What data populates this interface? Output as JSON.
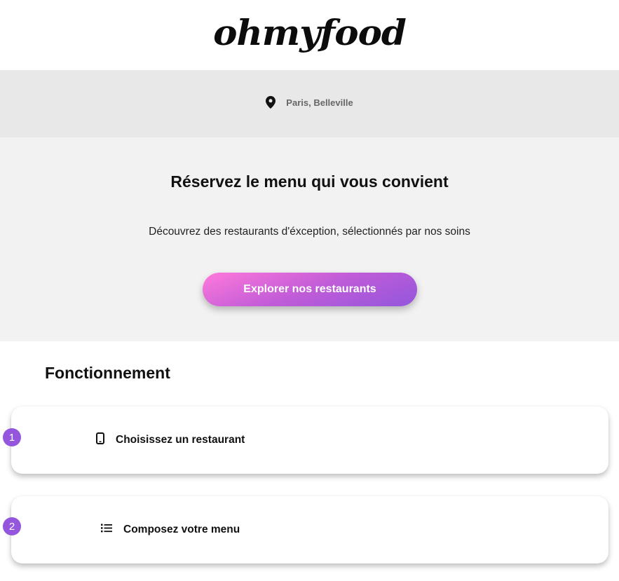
{
  "header": {
    "logo": "ohmyfood"
  },
  "location": {
    "icon": "map-pin-icon",
    "text": "Paris, Belleville"
  },
  "hero": {
    "title": "Réservez le menu qui vous convient",
    "subtitle": "Découvrez des restaurants d'éxception, sélectionnés par nos soins",
    "cta_label": "Explorer nos restaurants"
  },
  "how_it_works": {
    "title": "Fonctionnement",
    "steps": [
      {
        "number": "1",
        "icon": "mobile-phone-icon",
        "label": "Choisissez un restaurant"
      },
      {
        "number": "2",
        "icon": "list-icon",
        "label": "Composez votre menu"
      }
    ]
  },
  "colors": {
    "accent_pink": "#ff79da",
    "accent_purple": "#9356dc",
    "location_bg": "#e8e8e8",
    "hero_bg": "#f2f2f2"
  }
}
